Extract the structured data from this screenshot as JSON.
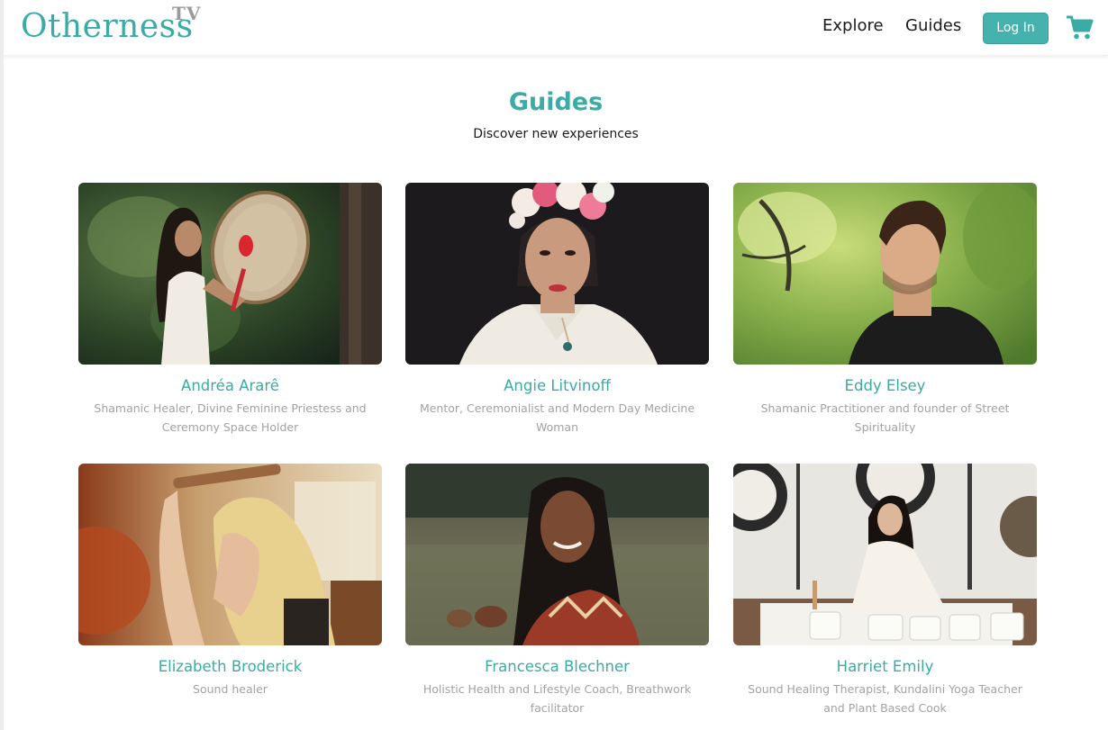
{
  "brand": {
    "logo_text": "Otherness",
    "logo_suffix": "TV",
    "accent_color": "#3aaba5"
  },
  "nav": {
    "explore": "Explore",
    "guides": "Guides",
    "login": "Log In",
    "cart_icon": "shopping-cart-icon"
  },
  "page": {
    "title": "Guides",
    "subtitle": "Discover new experiences"
  },
  "guides": [
    {
      "name": "Andréa Ararê",
      "description": "Shamanic Healer, Divine Feminine Priestess and Ceremony Space Holder"
    },
    {
      "name": "Angie Litvinoff",
      "description": "Mentor, Ceremonialist and Modern Day Medicine Woman"
    },
    {
      "name": "Eddy Elsey",
      "description": "Shamanic Practitioner and founder of Street Spirituality"
    },
    {
      "name": "Elizabeth Broderick",
      "description": "Sound healer"
    },
    {
      "name": "Francesca Blechner",
      "description": "Holistic Health and Lifestyle Coach, Breathwork facilitator"
    },
    {
      "name": "Harriet Emily",
      "description": "Sound Healing Therapist, Kundalini Yoga Teacher and Plant Based Cook"
    }
  ]
}
